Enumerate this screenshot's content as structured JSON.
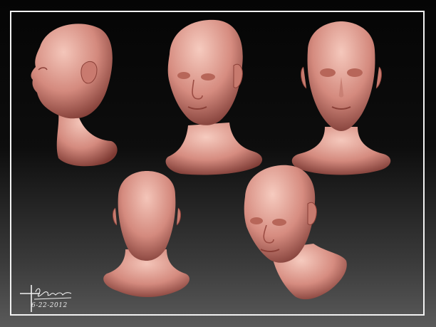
{
  "image": {
    "frame_color": "#f2f2f2",
    "skin_colors": {
      "light": "#f2c0b4",
      "mid": "#d98c80",
      "dark": "#8a3f37"
    },
    "background_top": "#050505",
    "background_bottom": "#5a5a5a"
  },
  "signature": {
    "name_scribble": "Gabriel Lemos",
    "date": "6-22-2012"
  }
}
